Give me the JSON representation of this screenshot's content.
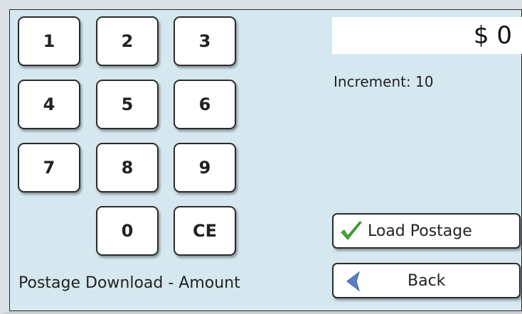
{
  "keypad": {
    "keys": [
      "1",
      "2",
      "3",
      "4",
      "5",
      "6",
      "7",
      "8",
      "9",
      "0",
      "CE"
    ]
  },
  "amount": {
    "display": "$ 0"
  },
  "info": {
    "increment": "Increment: 10"
  },
  "actions": {
    "load_label": "Load Postage",
    "back_label": "Back",
    "load_icon": "checkmark-icon",
    "back_icon": "back-arrow-icon",
    "check_color": "#4aa83a",
    "back_color": "#5b7fc8"
  },
  "page": {
    "title": "Postage Download - Amount"
  }
}
